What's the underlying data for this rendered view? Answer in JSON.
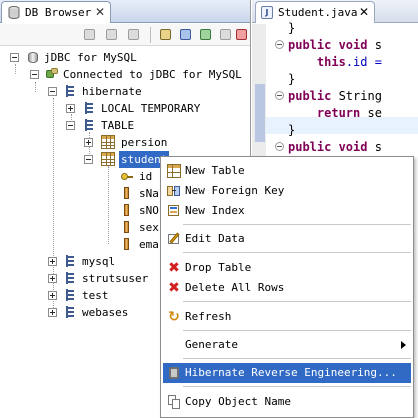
{
  "left_view": {
    "tab_title": "DB Browser",
    "tab_close": "✕"
  },
  "tree": {
    "root": "jDBC for MySQL",
    "connection": "Connected to jDBC for MySQL",
    "schema_hibernate": "hibernate",
    "local_temporary": "LOCAL TEMPORARY",
    "table_folder": "TABLE",
    "table_persion": "persion",
    "table_student": "student",
    "columns": [
      "id",
      "sNa",
      "sNO",
      "sex",
      "ema"
    ],
    "schemas_other": [
      "mysql",
      "strutsuser",
      "test",
      "webases"
    ]
  },
  "editor": {
    "tab_title": "Student.java",
    "tab_close": "✕",
    "lines": [
      {
        "pre": "",
        "kw": "",
        "rest": "}"
      },
      {
        "pre": "",
        "kw": "public void",
        "rest": " s"
      },
      {
        "pre": "    ",
        "kw": "this",
        "rest": ".id ="
      },
      {
        "pre": "",
        "kw": "",
        "rest": "}"
      },
      {
        "pre": "",
        "kw": "public",
        "rest": " String"
      },
      {
        "pre": "    ",
        "kw": "return",
        "rest": " se"
      },
      {
        "pre": "",
        "kw": "",
        "rest": "}"
      },
      {
        "pre": "",
        "kw": "public void",
        "rest": " s"
      }
    ]
  },
  "context_menu": {
    "new_table": "New Table",
    "new_foreign_key": "New Foreign Key",
    "new_index": "New Index",
    "edit_data": "Edit Data",
    "drop_table": "Drop Table",
    "delete_all_rows": "Delete All Rows",
    "refresh": "Refresh",
    "generate": "Generate",
    "hibernate_reverse_engineering": "Hibernate Reverse Engineering...",
    "copy_object_name": "Copy Object Name"
  },
  "colors": {
    "selection": "#316ac5",
    "keyword": "#7f0055",
    "field": "#0000c0"
  }
}
